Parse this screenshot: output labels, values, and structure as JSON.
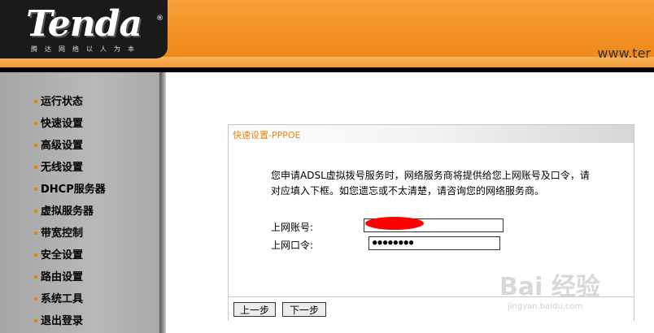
{
  "header": {
    "logo": "Tenda",
    "logo_mark": "®",
    "tagline": "腾达网络以人为本",
    "url_text": "www.ter"
  },
  "sidebar": {
    "items": [
      {
        "label": "运行状态"
      },
      {
        "label": "快速设置"
      },
      {
        "label": "高级设置"
      },
      {
        "label": "无线设置"
      },
      {
        "label": "DHCP服务器"
      },
      {
        "label": "虚拟服务器"
      },
      {
        "label": "带宽控制"
      },
      {
        "label": "安全设置"
      },
      {
        "label": "路由设置"
      },
      {
        "label": "系统工具"
      },
      {
        "label": "退出登录"
      }
    ]
  },
  "panel": {
    "title": "快速设置-PPPOE",
    "description": "您申请ADSL虚拟拨号服务时，网络服务商将提供给您上网账号及口令，请对应填入下框。如您遗忘或不太清楚，请咨询您的网络服务商。",
    "account_label": "上网账号:",
    "account_value": "",
    "password_label": "上网口令:",
    "password_value": "●●●●●●●●",
    "prev_button": "上一步",
    "next_button": "下一步"
  },
  "watermark": {
    "text": "Bai 经验",
    "url": "jingyan.baidu.com"
  },
  "colors": {
    "header_orange": "#f29022",
    "accent_orange": "#e8850f",
    "sidebar_gray": "#b0b0b0",
    "redaction": "#ff0000"
  }
}
